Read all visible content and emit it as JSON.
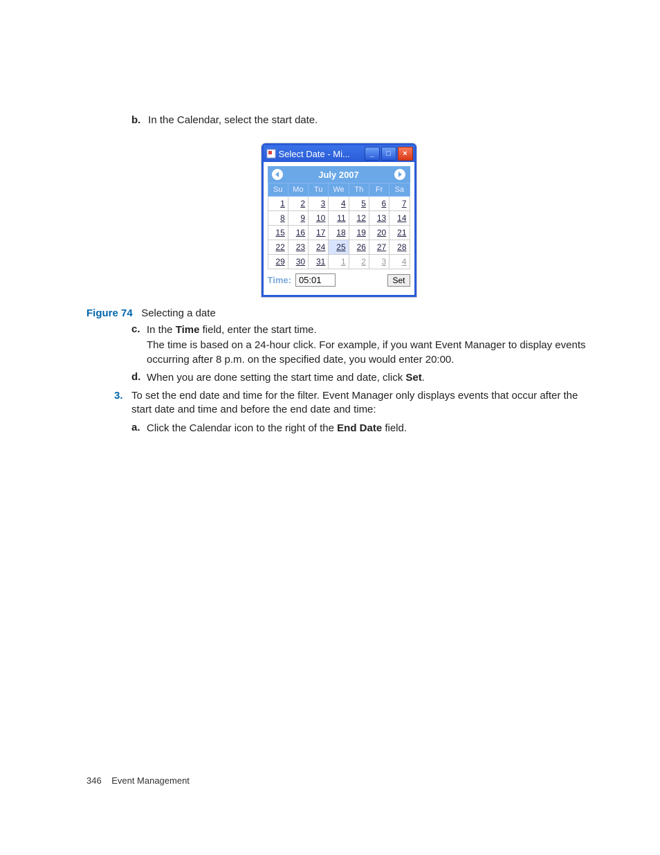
{
  "step_b": {
    "marker": "b.",
    "text_before": "In the Calendar, select the start date."
  },
  "dialog": {
    "title": "Select Date - Mi...",
    "month": "July 2007",
    "day_headers": [
      "Su",
      "Mo",
      "Tu",
      "We",
      "Th",
      "Fr",
      "Sa"
    ],
    "weeks": [
      [
        {
          "d": "1"
        },
        {
          "d": "2"
        },
        {
          "d": "3"
        },
        {
          "d": "4"
        },
        {
          "d": "5"
        },
        {
          "d": "6"
        },
        {
          "d": "7"
        }
      ],
      [
        {
          "d": "8"
        },
        {
          "d": "9"
        },
        {
          "d": "10"
        },
        {
          "d": "11"
        },
        {
          "d": "12"
        },
        {
          "d": "13"
        },
        {
          "d": "14"
        }
      ],
      [
        {
          "d": "15"
        },
        {
          "d": "16"
        },
        {
          "d": "17"
        },
        {
          "d": "18"
        },
        {
          "d": "19"
        },
        {
          "d": "20"
        },
        {
          "d": "21"
        }
      ],
      [
        {
          "d": "22"
        },
        {
          "d": "23"
        },
        {
          "d": "24"
        },
        {
          "d": "25",
          "sel": true
        },
        {
          "d": "26"
        },
        {
          "d": "27"
        },
        {
          "d": "28"
        }
      ],
      [
        {
          "d": "29"
        },
        {
          "d": "30"
        },
        {
          "d": "31"
        },
        {
          "d": "1",
          "off": true
        },
        {
          "d": "2",
          "off": true
        },
        {
          "d": "3",
          "off": true
        },
        {
          "d": "4",
          "off": true
        }
      ]
    ],
    "time_label": "Time:",
    "time_value": "05:01",
    "set_label": "Set"
  },
  "figure": {
    "label": "Figure 74",
    "caption": "Selecting a date"
  },
  "step_c": {
    "marker": "c.",
    "line1_pre": "In the ",
    "line1_bold": "Time",
    "line1_post": " field, enter the start time.",
    "line2": "The time is based on a 24-hour click. For example, if you want Event Manager to display events occurring after 8 p.m. on the specified date, you would enter 20:00."
  },
  "step_d": {
    "marker": "d.",
    "pre": "When you are done setting the start time and date, click ",
    "bold": "Set",
    "post": "."
  },
  "step_3": {
    "marker": "3.",
    "text": "To set the end date and time for the filter. Event Manager only displays events that occur after the start date and time and before the end date and time:"
  },
  "step_3a": {
    "marker": "a.",
    "pre": "Click the Calendar icon to the right of the ",
    "bold": "End Date",
    "post": " field."
  },
  "footer": {
    "page": "346",
    "section": "Event Management"
  }
}
